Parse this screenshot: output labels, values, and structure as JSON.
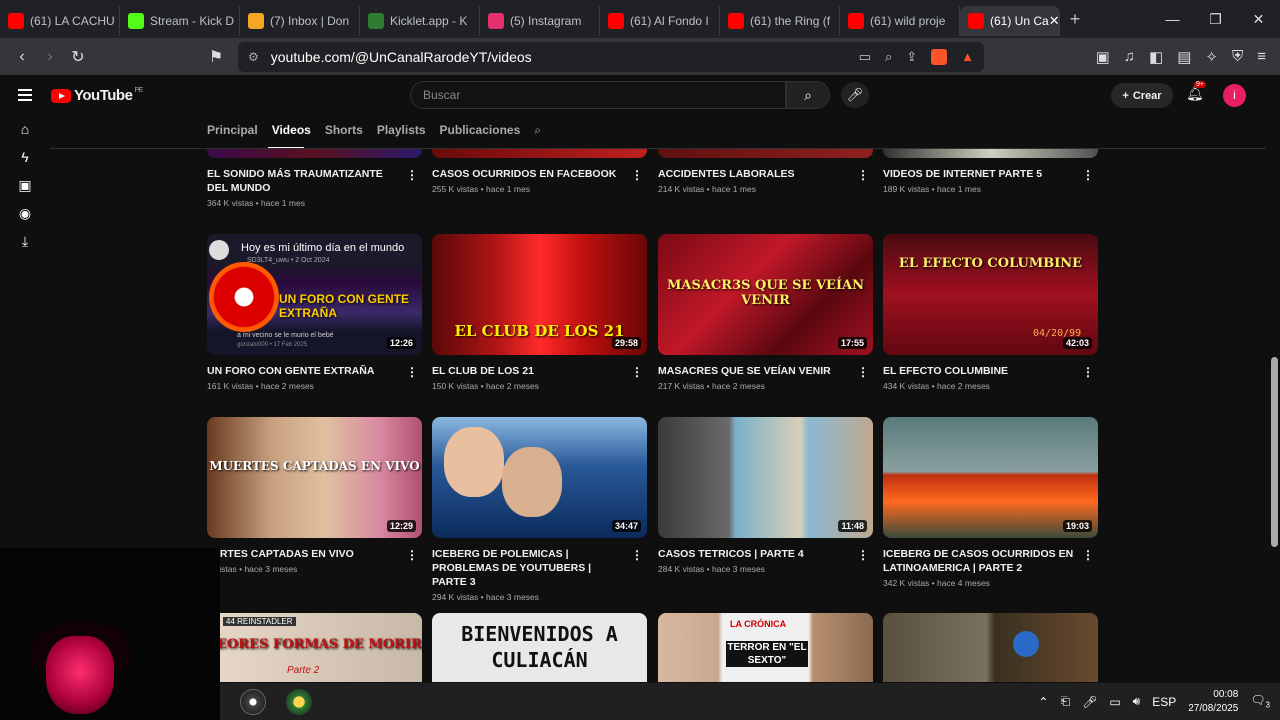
{
  "browser": {
    "tabs": [
      {
        "label": "(61) LA CACHU",
        "color": "#ff0000"
      },
      {
        "label": "Stream - Kick D",
        "color": "#53fc18"
      },
      {
        "label": "(7) Inbox | Don",
        "color": "#f5a623"
      },
      {
        "label": "Kicklet.app - K",
        "color": "#2e7d32"
      },
      {
        "label": "(5) Instagram",
        "color": "#e1306c"
      },
      {
        "label": "(61) Al Fondo I",
        "color": "#ff0000"
      },
      {
        "label": "(61) the Ring (f",
        "color": "#ff0000"
      },
      {
        "label": "(61) wild proje",
        "color": "#ff0000"
      },
      {
        "label": "(61) Un Ca",
        "color": "#ff0000"
      }
    ],
    "url": "youtube.com/@UnCanalRarodeYT/videos",
    "brave_count": "78"
  },
  "header": {
    "logo": "YouTube",
    "region": "PE",
    "search_placeholder": "Buscar",
    "create_label": "Crear",
    "notif_badge": "9+",
    "avatar_letter": "i"
  },
  "channel_tabs": [
    "Principal",
    "Videos",
    "Shorts",
    "Playlists",
    "Publicaciones"
  ],
  "row0": [
    {
      "title": "EL SONIDO MÁS TRAUMATIZANTE DEL MUNDO",
      "meta": "364 K vistas • hace 1 mes"
    },
    {
      "title": "CASOS OCURRIDOS EN FACEBOOK",
      "meta": "255 K vistas • hace 1 mes"
    },
    {
      "title": "ACCIDENTES LABORALES",
      "meta": "214 K vistas • hace 1 mes"
    },
    {
      "title": "VIDEOS DE INTERNET PARTE 5",
      "meta": "189 K vistas • hace 1 mes"
    }
  ],
  "row1": [
    {
      "title": "UN FORO CON GENTE EXTRAÑA",
      "meta": "161 K vistas • hace 2 meses",
      "duration": "12:26",
      "overlay": "UN FORO CON GENTE EXTRAÑA",
      "post_text": "Hoy es mi último día en el mundo",
      "post_user": "SD3LT4_uwu • 2 Oct 2024",
      "reply": "a mi vecino se le murio el bebé",
      "reply_meta": "gonzalo000 • 17 Feb 2025"
    },
    {
      "title": "EL CLUB DE LOS 21",
      "meta": "150 K vistas • hace 2 meses",
      "duration": "29:58",
      "overlay": "EL CLUB DE LOS 21"
    },
    {
      "title": "MASACRES QUE SE VEÍAN VENIR",
      "meta": "217 K vistas • hace 2 meses",
      "duration": "17:55",
      "overlay": "MASACR3S QUE SE VEÍAN VENIR"
    },
    {
      "title": "EL EFECTO COLUMBINE",
      "meta": "434 K vistas • hace 2 meses",
      "duration": "42:03",
      "overlay": "EL EFECTO COLUMBINE",
      "stamp": "04/20/99"
    }
  ],
  "row2": [
    {
      "title": "JERTES CAPTADAS EN VIVO",
      "meta": "K vistas • hace 3 meses",
      "duration": "12:29",
      "overlay": "MUERTES CAPTADAS EN VIVO"
    },
    {
      "title": "ICEBERG DE POLEMICAS | PROBLEMAS DE YOUTUBERS | PARTE 3",
      "meta": "294 K vistas • hace 3 meses",
      "duration": "34:47"
    },
    {
      "title": "CASOS TETRICOS | PARTE 4",
      "meta": "284 K vistas • hace 3 meses",
      "duration": "11:48"
    },
    {
      "title": "ICEBERG DE CASOS OCURRIDOS EN LATINOAMERICA | PARTE 2",
      "meta": "342 K vistas • hace 4 meses",
      "duration": "19:03"
    }
  ],
  "row3": [
    {
      "overlay": "PEORES FORMAS DE MORIR",
      "tag": "44 REINSTADLER",
      "sub": "Parte 2"
    },
    {
      "overlay": "BIENVENIDOS A CULIACÁN"
    },
    {
      "overlay": "TERROR EN \"EL SEXTO\"",
      "paper": "LA CRÓNICA"
    },
    {
      "overlay": ""
    }
  ],
  "taskbar": {
    "lang": "ESP",
    "time": "00:08",
    "date": "27/08/2025",
    "notif": "3"
  }
}
